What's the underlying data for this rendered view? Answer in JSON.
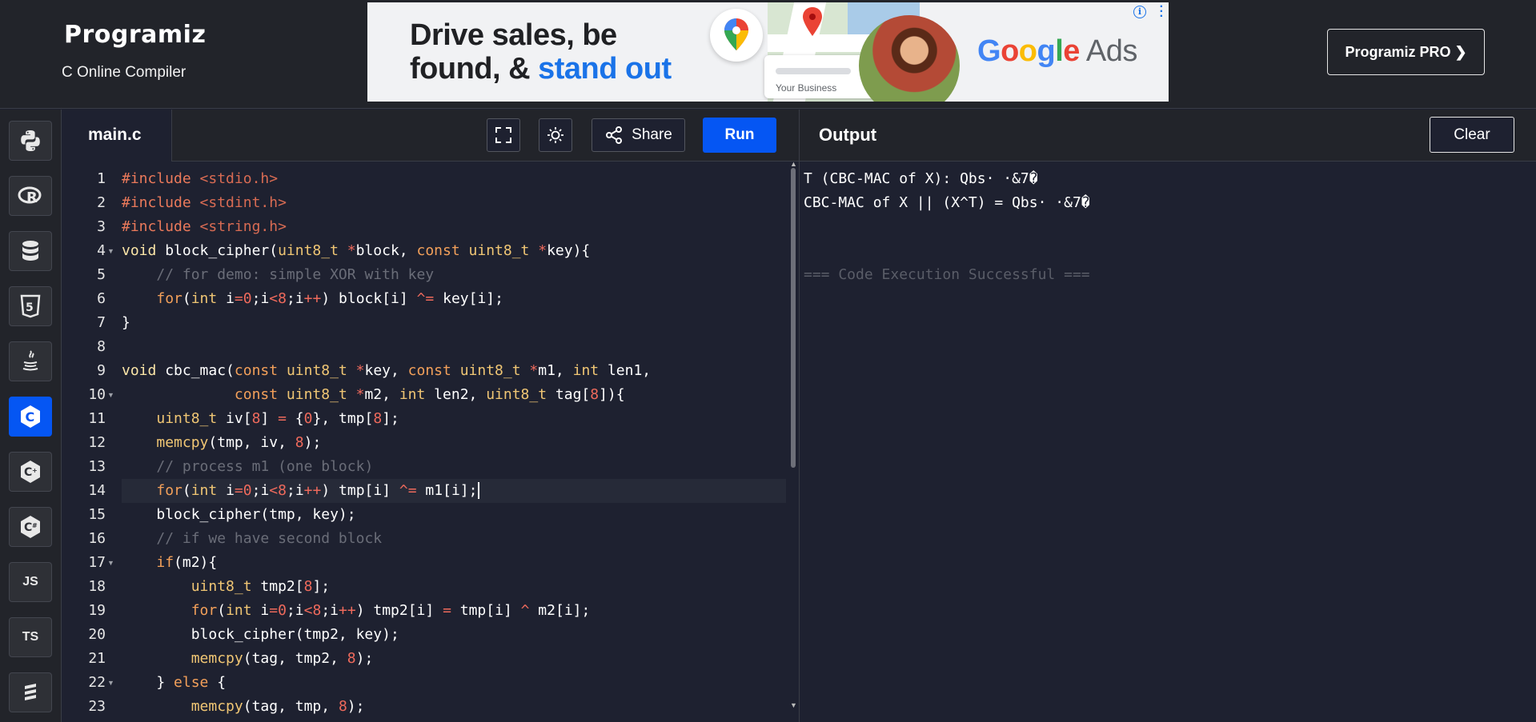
{
  "header": {
    "logo_text": "Programiz",
    "subtitle": "C Online Compiler",
    "pro_button": "Programiz PRO ❯"
  },
  "ad": {
    "headline_line1": "Drive sales, be",
    "headline_line2_plain": "found, & ",
    "headline_line2_blue": "stand out",
    "card_text": "Your Business",
    "brand_google": "Google",
    "brand_ads": " Ads",
    "info_icon": "info-icon",
    "colors": {
      "blue": "#1a73e8",
      "red": "#ea4335",
      "yellow": "#fbbc05",
      "green": "#34a853"
    }
  },
  "sidebar": {
    "items": [
      {
        "name": "python",
        "label": "",
        "icon": "python-icon"
      },
      {
        "name": "r",
        "label": "",
        "icon": "r-icon"
      },
      {
        "name": "sql",
        "label": "",
        "icon": "database-icon"
      },
      {
        "name": "html",
        "label": "",
        "icon": "html5-icon"
      },
      {
        "name": "java",
        "label": "",
        "icon": "java-icon"
      },
      {
        "name": "c",
        "label": "",
        "icon": "c-icon",
        "active": true
      },
      {
        "name": "cpp",
        "label": "",
        "icon": "cpp-icon"
      },
      {
        "name": "csharp",
        "label": "",
        "icon": "csharp-icon"
      },
      {
        "name": "javascript",
        "label": "JS",
        "icon": ""
      },
      {
        "name": "typescript",
        "label": "TS",
        "icon": ""
      },
      {
        "name": "swift",
        "label": "",
        "icon": "swift-icon"
      }
    ]
  },
  "editor": {
    "tab": "main.c",
    "share_label": "Share",
    "run_label": "Run",
    "current_line": 14,
    "lines": [
      "1",
      "2",
      "3",
      "4",
      "5",
      "6",
      "7",
      "8",
      "9",
      "10",
      "11",
      "12",
      "13",
      "14",
      "15",
      "16",
      "17",
      "18",
      "19",
      "20",
      "21",
      "22",
      "23"
    ],
    "code": [
      "#include <stdio.h>",
      "#include <stdint.h>",
      "#include <string.h>",
      "void block_cipher(uint8_t *block, const uint8_t *key){",
      "    // for demo: simple XOR with key",
      "    for(int i=0;i<8;i++) block[i] ^= key[i];",
      "}",
      "",
      "void cbc_mac(const uint8_t *key, const uint8_t *m1, int len1,",
      "             const uint8_t *m2, int len2, uint8_t tag[8]){",
      "    uint8_t iv[8] = {0}, tmp[8];",
      "    memcpy(tmp, iv, 8);",
      "    // process m1 (one block)",
      "    for(int i=0;i<8;i++) tmp[i] ^= m1[i];",
      "    block_cipher(tmp, key);",
      "    // if we have second block",
      "    if(m2){",
      "        uint8_t tmp2[8];",
      "        for(int i=0;i<8;i++) tmp2[i] = tmp[i] ^ m2[i];",
      "        block_cipher(tmp2, key);",
      "        memcpy(tag, tmp2, 8);",
      "    } else {",
      "        memcpy(tag, tmp, 8);"
    ]
  },
  "output": {
    "title": "Output",
    "clear_label": "Clear",
    "lines": [
      "T (CBC-MAC of X): Qbs· ·&7�",
      "CBC-MAC of X || (X^T) = Qbs· ·&7�",
      "",
      "",
      "=== Code Execution Successful ==="
    ]
  }
}
